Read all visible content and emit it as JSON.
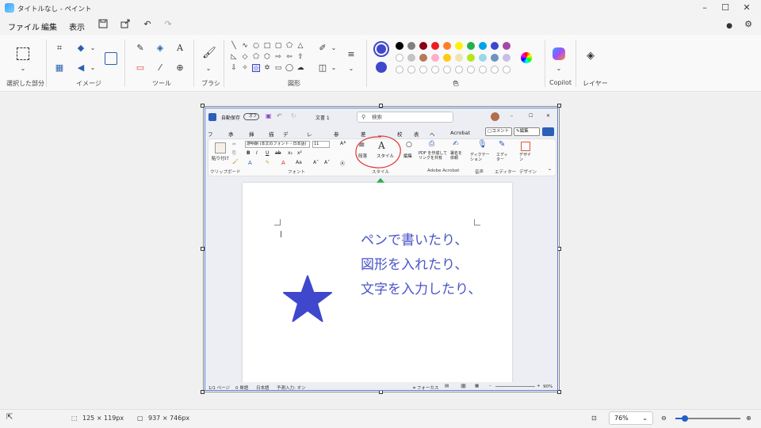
{
  "window": {
    "title": "タイトルなし - ペイント"
  },
  "menu": {
    "file": "ファイル",
    "edit": "編集",
    "view": "表示"
  },
  "groups": {
    "selection": "選択した部分",
    "image": "イメージ",
    "tools": "ツール",
    "brush": "ブラシ",
    "shapes": "図形",
    "colors": "色",
    "copilot": "Copilot",
    "layers": "レイヤー"
  },
  "colors": {
    "primary": "#3f48cc",
    "secondary": "#3f48cc",
    "palette_row1": [
      "#000000",
      "#7f7f7f",
      "#880015",
      "#ed1c24",
      "#ff7f27",
      "#fff200",
      "#22b14c",
      "#00a2e8",
      "#3f48cc",
      "#a349a4"
    ],
    "palette_row2": [
      "#ffffff",
      "#c3c3c3",
      "#b97a57",
      "#ffaec9",
      "#ffc90e",
      "#efe4b0",
      "#b5e61d",
      "#99d9ea",
      "#7092be",
      "#c8bfe7"
    ]
  },
  "word": {
    "autosave": "自動保存",
    "autosave_state": "オフ",
    "doc_title": "文書 1",
    "search_placeholder": "検索",
    "tabs": [
      "ファイル",
      "ホーム",
      "挿入",
      "描画",
      "デザイン",
      "レイアウト",
      "参考資料",
      "差し込み文書",
      "校閲",
      "表示",
      "ヘルプ",
      "Acrobat"
    ],
    "comment_button": "コメント",
    "edit_button": "編集",
    "font_name": "游明朝 (本文のフォント - 日本語)",
    "font_size": "11",
    "paste": "貼り付け",
    "paragraph": "段落",
    "style": "スタイル",
    "editing": "編集",
    "pdf_share": "PDF を作成して\nリンクを共有",
    "sign_request": "署名を依頼",
    "dictation": "ディクテーション",
    "editor": "エディター",
    "designer": "デザイン",
    "grp_clipboard": "クリップボード",
    "grp_font": "フォント",
    "grp_style": "スタイル",
    "grp_acrobat": "Adobe Acrobat",
    "grp_voice": "音声",
    "grp_editor": "エディター",
    "grp_designer": "デザイン",
    "status_page": "1/1 ページ",
    "status_words": "0 単語",
    "status_lang": "日本語",
    "status_ime": "予測入力: オン",
    "status_focus": "フォーカス",
    "status_zoom": "90%",
    "doc_lines": [
      "ペンで書いたり、",
      "図形を入れたり、",
      "文字を入力したり、"
    ]
  },
  "status": {
    "selection_size": "125 × 119px",
    "canvas_size": "937 × 746px",
    "zoom": "76%"
  }
}
